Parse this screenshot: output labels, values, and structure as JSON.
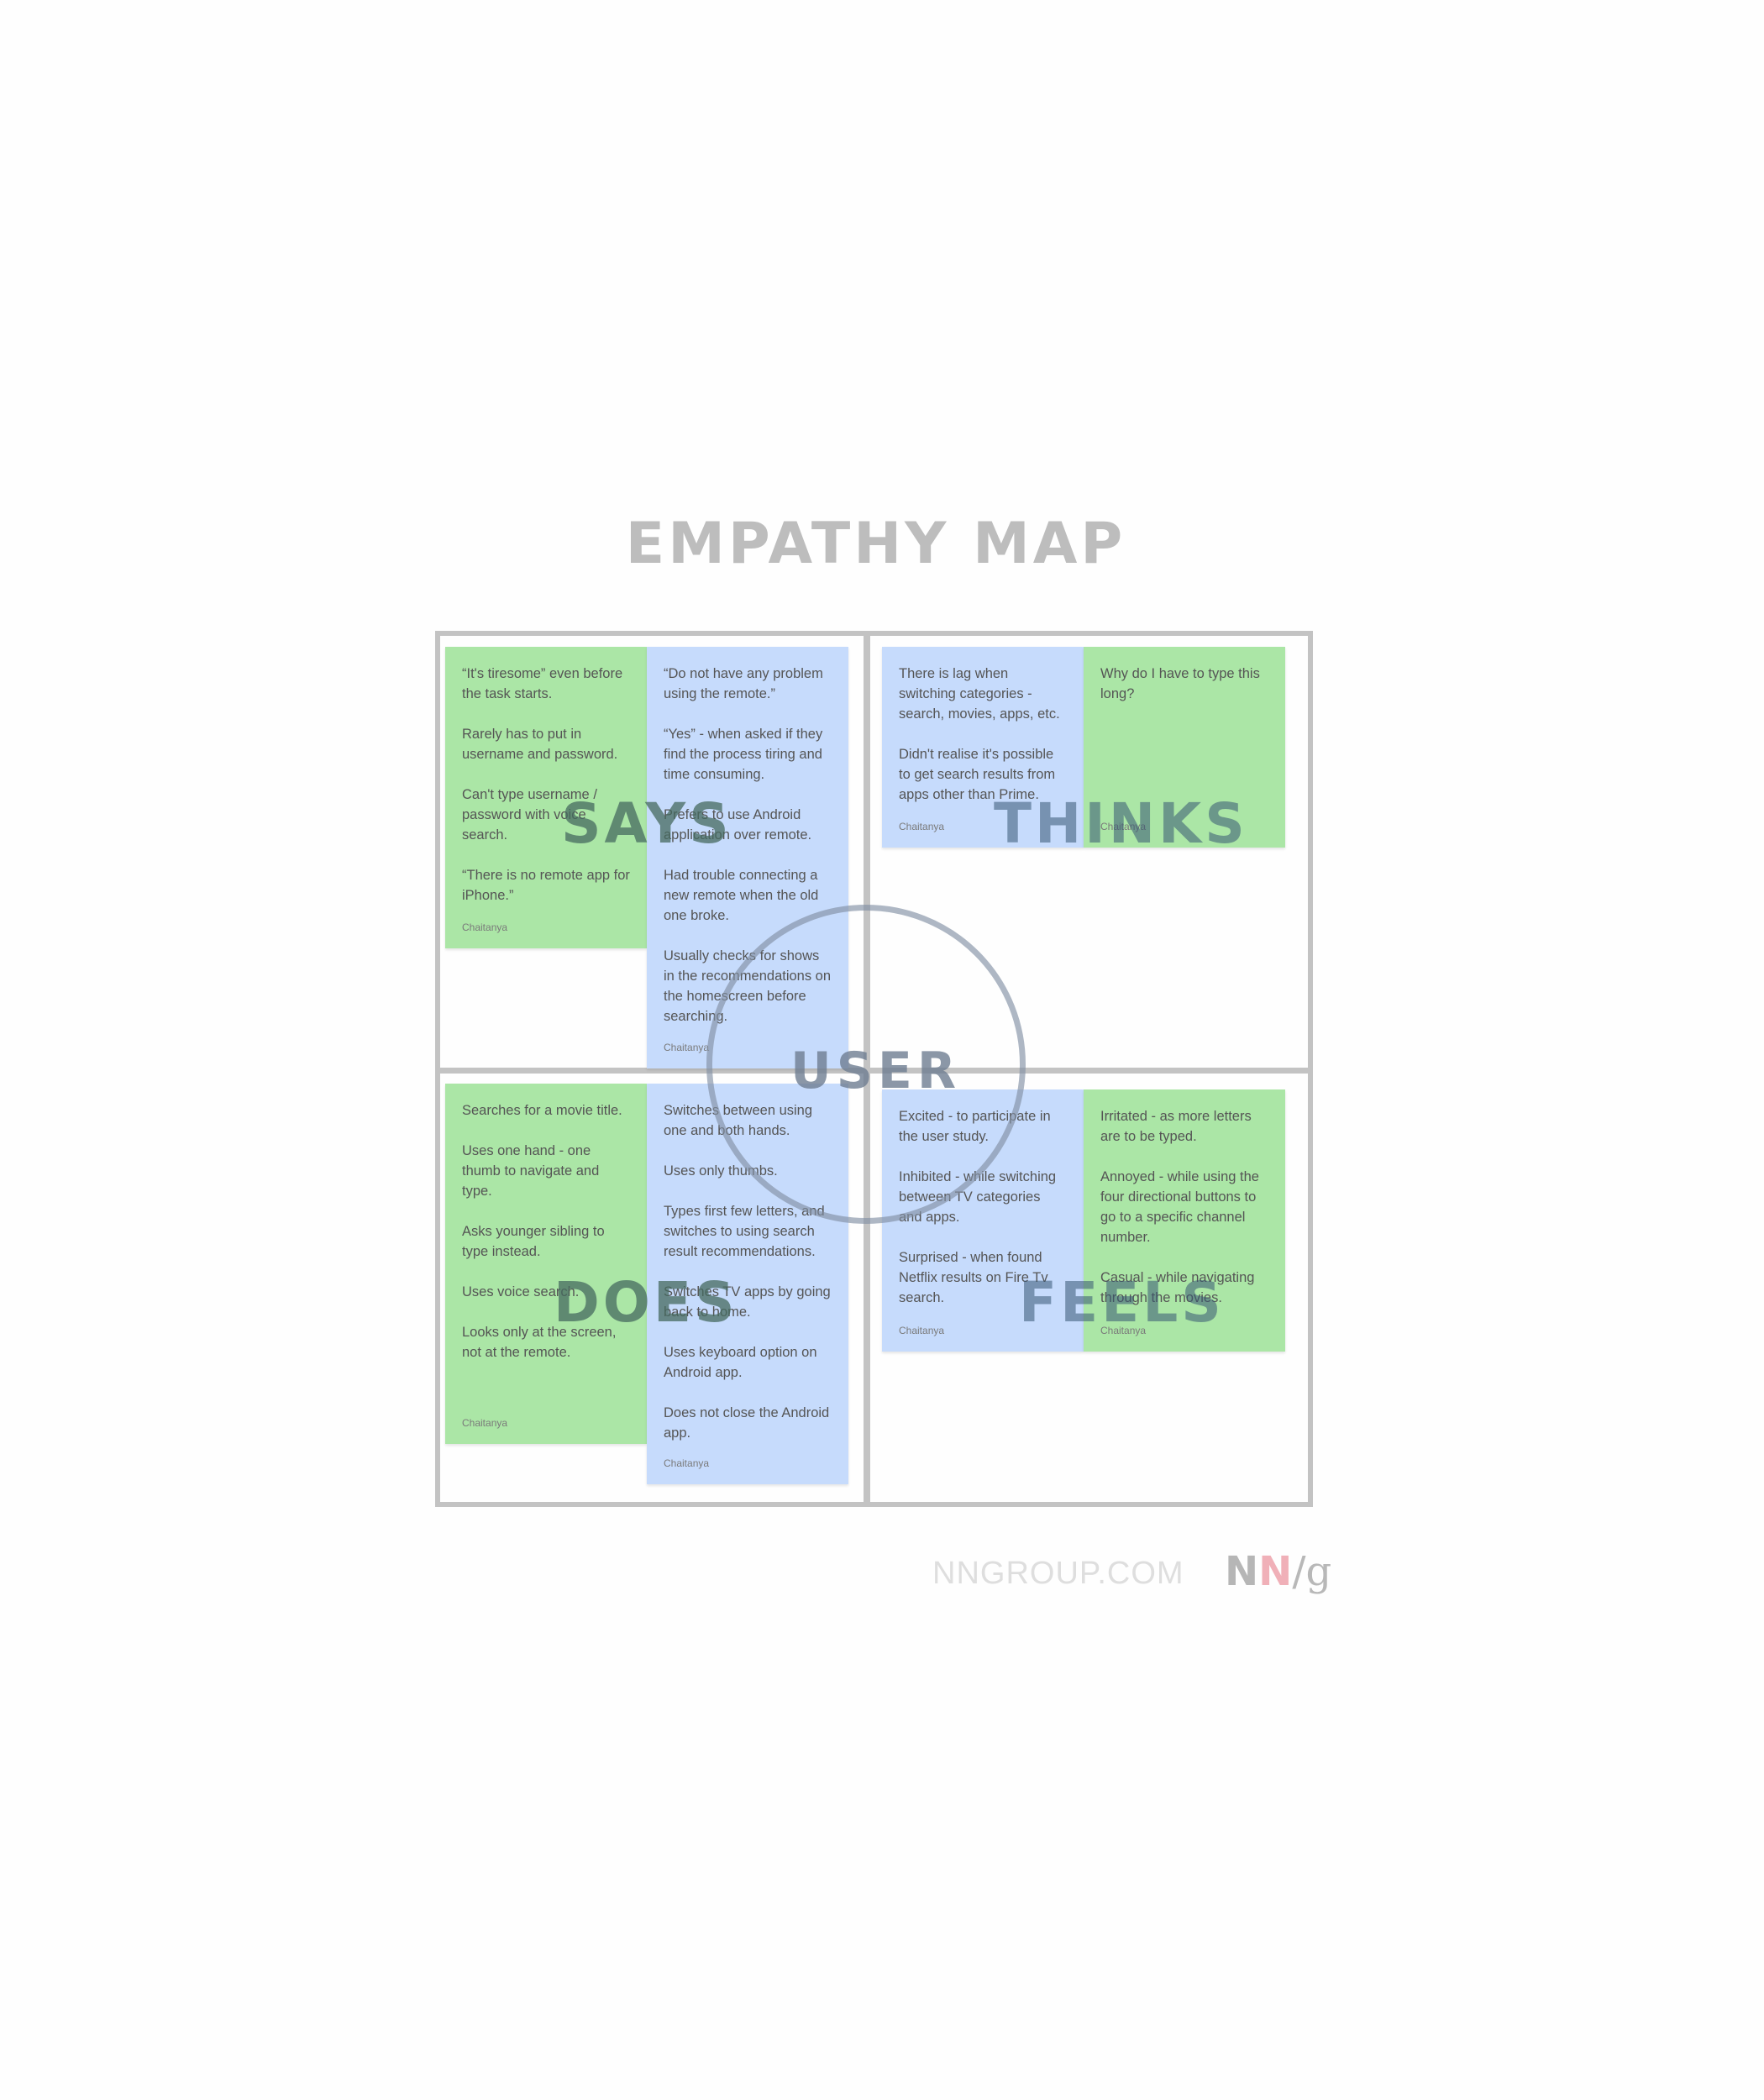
{
  "title": "EMPATHY MAP",
  "quadrants": {
    "says": "SAYS",
    "thinks": "THINKS",
    "does": "DOES",
    "feels": "FEELS"
  },
  "center_label": "USER",
  "notes": {
    "says_green": {
      "items": [
        "“It's tiresome” even before the task starts.",
        "Rarely has to put in username and password.",
        "Can't type username / password with voice search.",
        "“There is no remote app for iPhone.”"
      ],
      "author": "Chaitanya"
    },
    "says_blue": {
      "items": [
        "“Do not have any problem using the remote.”",
        "“Yes” - when asked if they find the process tiring and time consuming.",
        "Prefers to use Android application over remote.",
        "Had trouble connecting a new remote when the old one broke.",
        "Usually checks for shows in the recommendations on the homescreen before searching."
      ],
      "author": "Chaitanya"
    },
    "thinks_blue": {
      "items": [
        "There is lag when switching categories - search, movies, apps, etc.",
        "Didn't realise it's possible to get search results from apps other than Prime."
      ],
      "author": "Chaitanya"
    },
    "thinks_green": {
      "items": [
        "Why do I have to type this long?"
      ],
      "author": "Chaitanya"
    },
    "does_green": {
      "items": [
        "Searches for a movie title.",
        "Uses one hand - one thumb to navigate and type.",
        "Asks younger sibling to type instead.",
        "Uses voice search.",
        "Looks only at the screen, not at the remote."
      ],
      "author": "Chaitanya"
    },
    "does_blue": {
      "items": [
        "Switches between using one and both hands.",
        "Uses only thumbs.",
        "Types first few letters, and switches to using search result recommendations.",
        "Switches TV apps by going back to home.",
        "Uses keyboard option on Android app.",
        "Does not close the Android app."
      ],
      "author": "Chaitanya"
    },
    "feels_blue": {
      "items": [
        "Excited - to participate in the user study.",
        "Inhibited - while switching between TV categories and apps.",
        "Surprised - when found Netflix results on Fire Tv search."
      ],
      "author": "Chaitanya"
    },
    "feels_green": {
      "items": [
        "Irritated - as more letters are to be typed.",
        "Annoyed - while using the four directional buttons to go to a specific channel number.",
        "Casual - while navigating through the movies."
      ],
      "author": "Chaitanya"
    }
  },
  "footer": {
    "site": "NNGROUP.COM",
    "logo_n1": "N",
    "logo_n2": "N",
    "logo_slash": "/",
    "logo_g": "g"
  },
  "colors": {
    "sticky_green": "#abe6a6",
    "sticky_blue": "#c6dbfc",
    "frame": "#c3c3c3",
    "logo_pink": "#f0b0b8"
  }
}
